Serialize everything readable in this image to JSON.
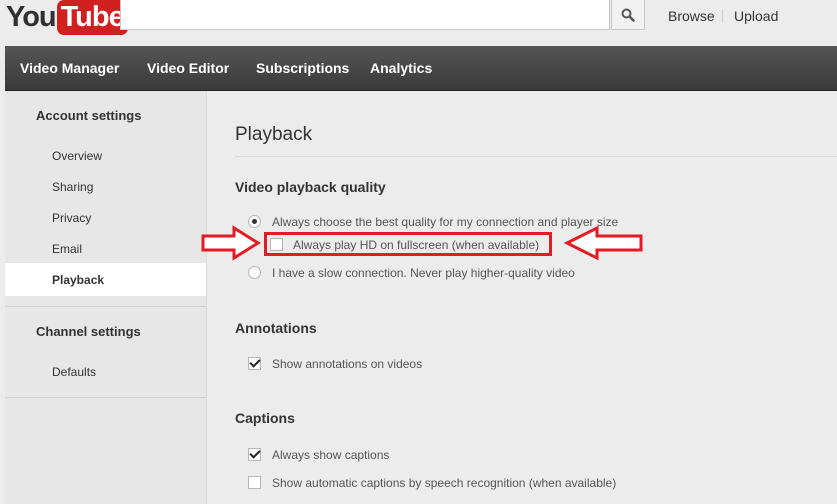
{
  "header": {
    "logo_you": "You",
    "logo_tube": "Tube",
    "search_placeholder": "",
    "links": [
      "Browse",
      "Upload"
    ]
  },
  "nav": {
    "items": [
      "Video Manager",
      "Video Editor",
      "Subscriptions",
      "Analytics"
    ]
  },
  "sidebar": {
    "account_heading": "Account settings",
    "account_items": [
      "Overview",
      "Sharing",
      "Privacy",
      "Email",
      "Playback"
    ],
    "active_item": "Playback",
    "channel_heading": "Channel settings",
    "channel_items": [
      "Defaults"
    ]
  },
  "main": {
    "title": "Playback",
    "quality": {
      "heading": "Video playback quality",
      "best_label": "Always choose the best quality for my connection and player size",
      "best_selected": true,
      "hd_label": "Always play HD on fullscreen (when available)",
      "hd_checked": false,
      "slow_label": "I have a slow connection. Never play higher-quality video",
      "slow_selected": false
    },
    "annotations": {
      "heading": "Annotations",
      "show_label": "Show annotations on videos",
      "show_checked": true
    },
    "captions": {
      "heading": "Captions",
      "always_label": "Always show captions",
      "always_checked": true,
      "auto_label": "Show automatic captions by speech recognition (when available)",
      "auto_checked": false
    }
  },
  "colors": {
    "brand_red": "#d21f1f",
    "highlight_red": "#e31b23",
    "nav_bg": "#3f3f3f"
  }
}
